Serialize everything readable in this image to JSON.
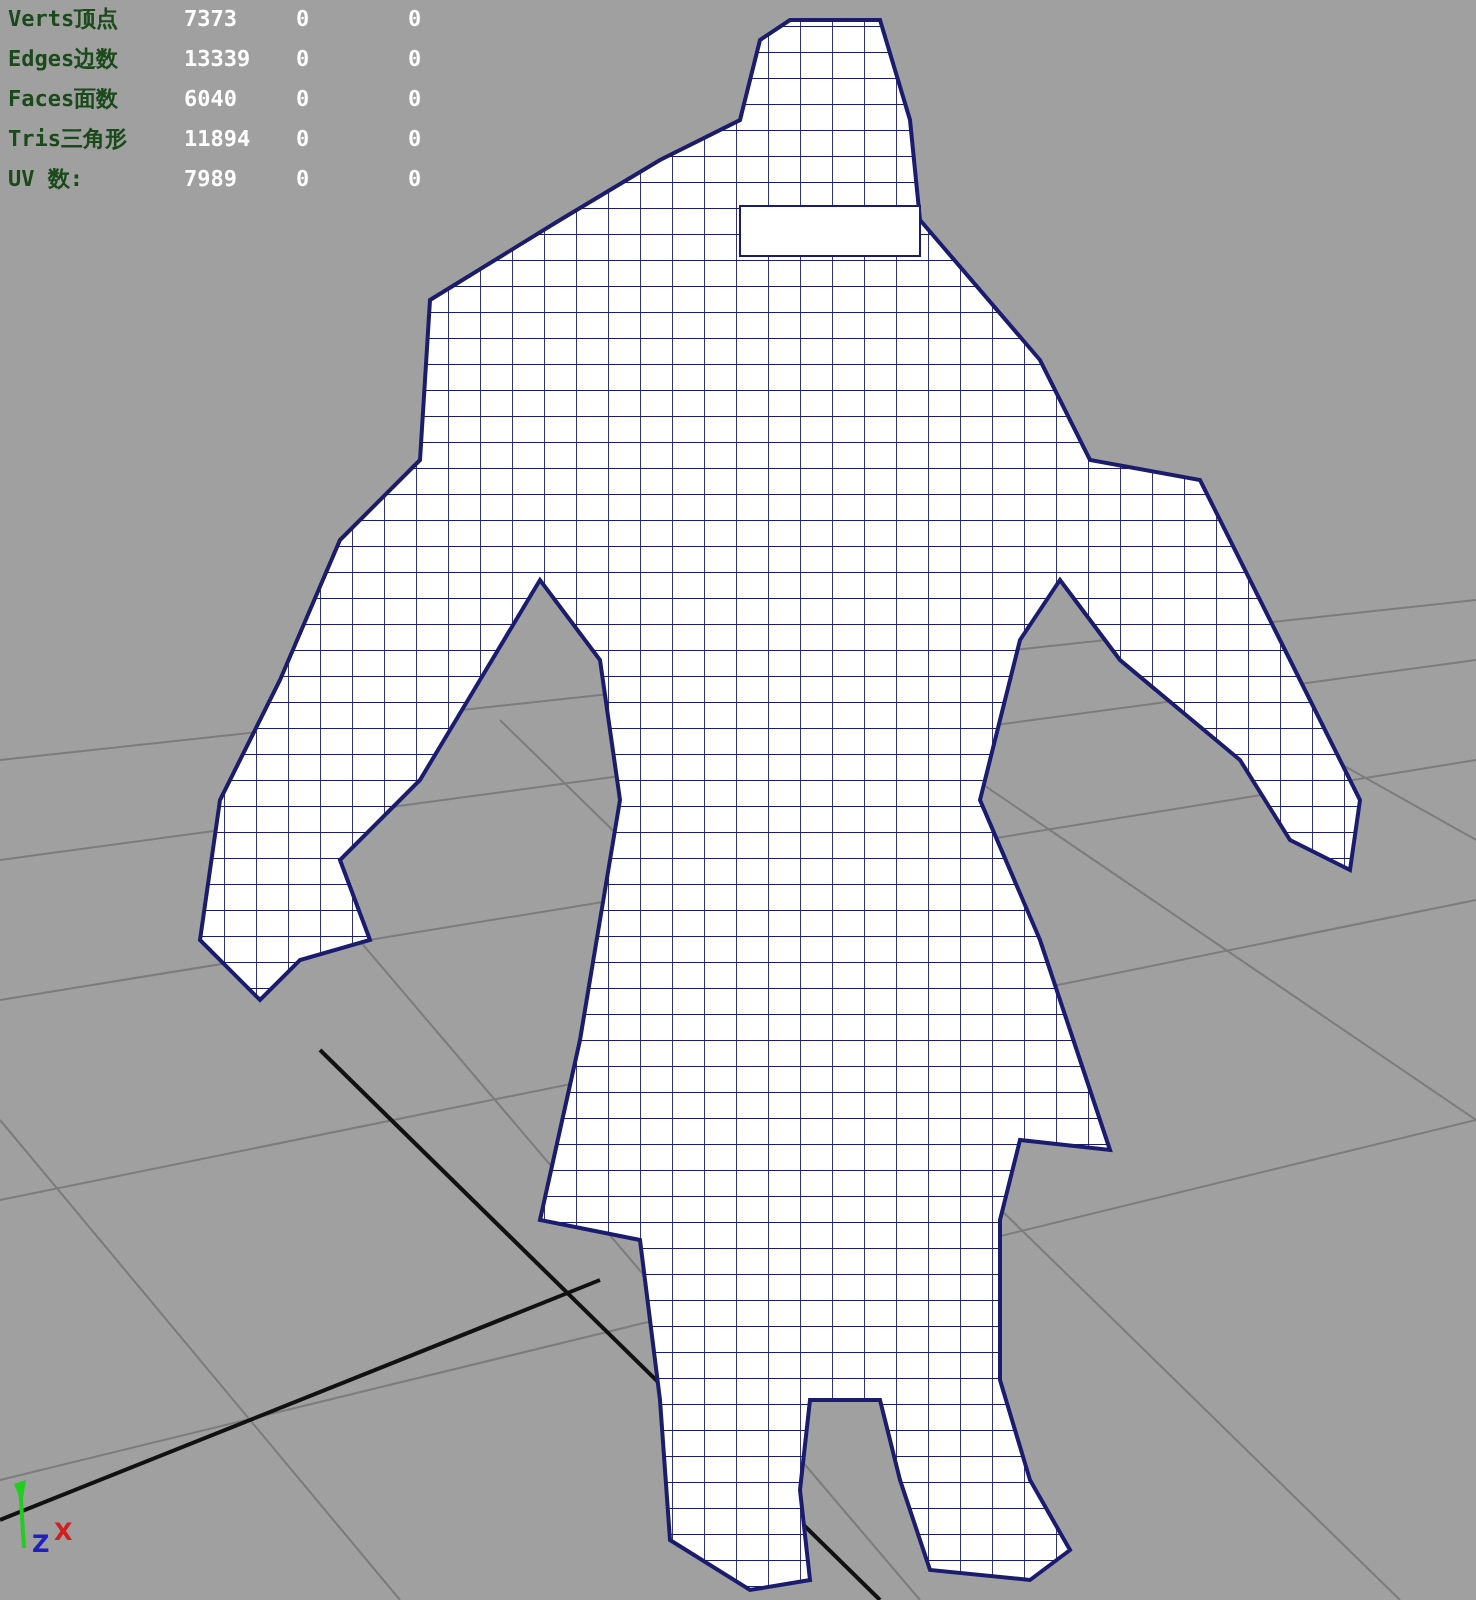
{
  "viewport": {
    "stats": [
      {
        "label": "Verts顶点",
        "values": [
          "7373",
          "0",
          "0"
        ]
      },
      {
        "label": "Edges边数",
        "values": [
          "13339",
          "0",
          "0"
        ]
      },
      {
        "label": "Faces面数",
        "values": [
          "6040",
          "0",
          "0"
        ]
      },
      {
        "label": "Tris三角形",
        "values": [
          "11894",
          "0",
          "0"
        ]
      },
      {
        "label": "UV 数:",
        "values": [
          "7989",
          "0",
          "0"
        ]
      }
    ],
    "axis_gizmo": {
      "labels": [
        "Z",
        "X"
      ]
    }
  }
}
